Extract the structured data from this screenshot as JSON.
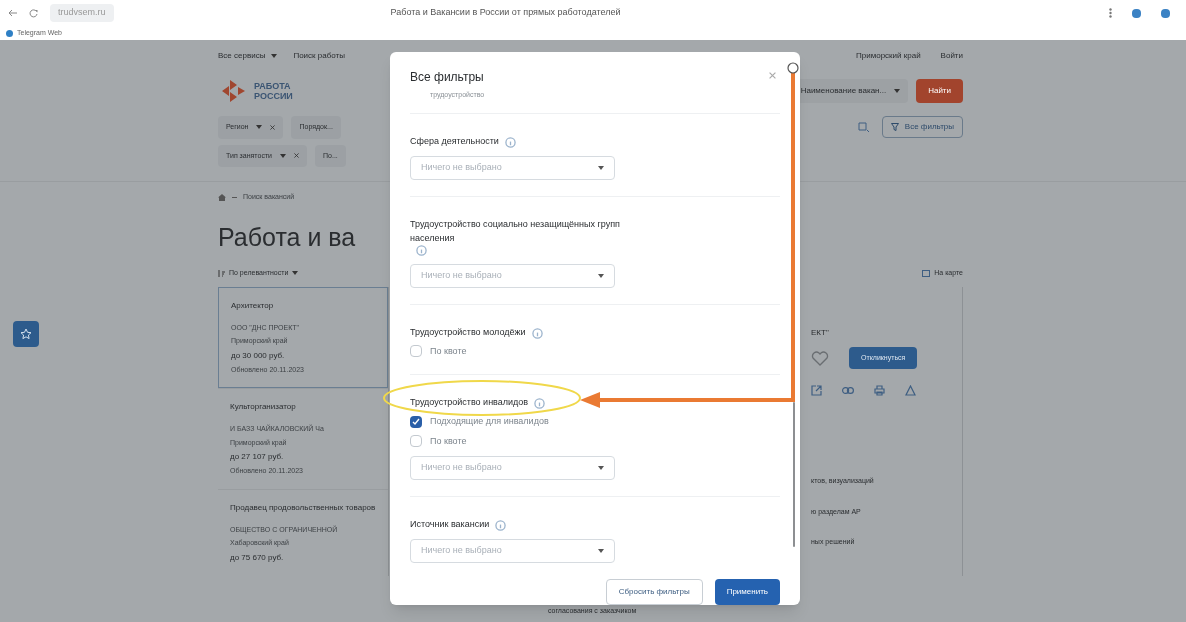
{
  "browser": {
    "url": "trudvsem.ru",
    "tab_title": "Работа и Вакансии в России от прямых работодателей",
    "bookmarks": [
      "Telegram Web"
    ]
  },
  "header": {
    "nav": [
      "Все сервисы",
      "Поиск работы"
    ],
    "nav_right": [
      "Приморский край",
      "Войти"
    ],
    "logo": "РАБОТА РОССИИ",
    "search_select": "Наименование вакан...",
    "search_button": "Найти",
    "chips_row_1": [
      "Регион",
      "Порядок..."
    ],
    "chips_row_2": [
      "Тип занятости",
      "По..."
    ],
    "all_filters": "Все фильтры"
  },
  "breadcrumb": "Поиск вакансий",
  "heading": "Работа и ва",
  "sort": "По релевантности",
  "map_link": "На карте",
  "vacancies": [
    {
      "title": "Архитектор",
      "company": "ООО \"ДНС ПРОЕКТ\"",
      "region": "Приморский край",
      "salary": "до 30 000 руб.",
      "updated": "Обновлено 20.11.2023",
      "selected": true
    },
    {
      "title": "Культорганизатор",
      "company": "И БАЗЗ ЧАЙКАЛОВСКИЙ Ча",
      "region": "Приморский край",
      "salary": "до 27 107 руб.",
      "updated": "Обновлено 20.11.2023",
      "selected": false
    },
    {
      "title": "Продавец продовольственных товаров",
      "company": "ОБЩЕСТВО С ОГРАНИЧЕННОЙ",
      "region": "Хабаровский край",
      "salary": "до 75 670 руб.",
      "selected": false
    }
  ],
  "detail": {
    "company_tail": "ЕКТ\"",
    "respond_button": "Откликнуться",
    "lines": [
      "ктов, визуализаций",
      "ю разделам АР",
      "ных решений"
    ],
    "bottom_line": "согласования с заказчиком"
  },
  "modal": {
    "title": "Все фильтры",
    "scrolled_text": "трудоустройство",
    "footer": {
      "reset": "Сбросить фильтры",
      "apply": "Применить"
    },
    "sections": [
      {
        "title": "Сфера деятельности",
        "controls": [
          {
            "kind": "select",
            "placeholder": "Ничего не выбрано"
          }
        ]
      },
      {
        "title": "Трудоустройство социально незащищённых групп населения",
        "controls": [
          {
            "kind": "select",
            "placeholder": "Ничего не выбрано"
          }
        ]
      },
      {
        "title": "Трудоустройство молодёжи",
        "controls": [
          {
            "kind": "checkbox",
            "label": "По квоте",
            "checked": false
          }
        ]
      },
      {
        "title": "Трудоустройство инвалидов",
        "controls": [
          {
            "kind": "checkbox",
            "label": "Подходящие для инвалидов",
            "checked": true
          },
          {
            "kind": "checkbox",
            "label": "По квоте",
            "checked": false
          },
          {
            "kind": "select",
            "placeholder": "Ничего не выбрано"
          }
        ]
      },
      {
        "title": "Источник вакансии",
        "controls": [
          {
            "kind": "select",
            "placeholder": "Ничего не выбрано"
          }
        ]
      }
    ]
  }
}
